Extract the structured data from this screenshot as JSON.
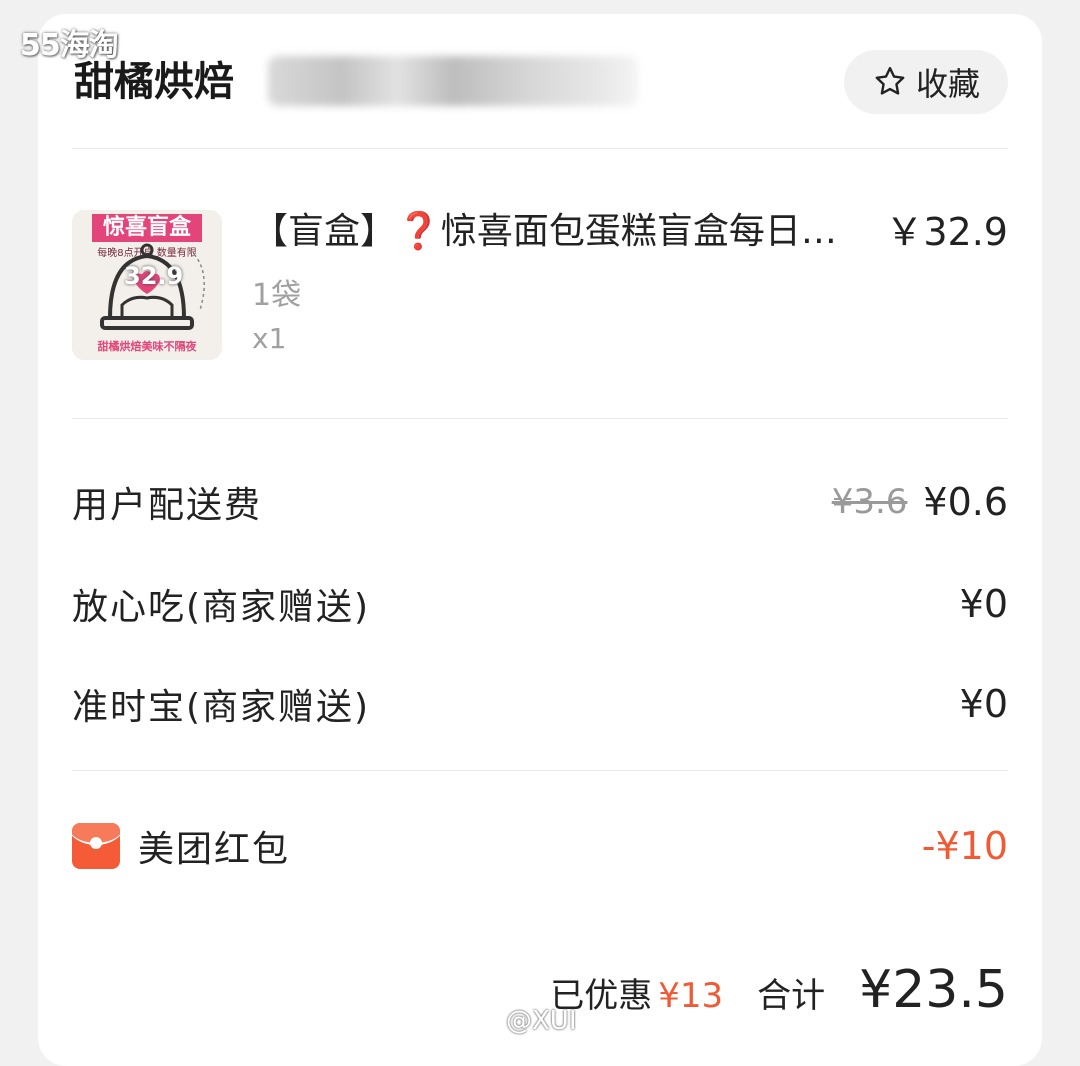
{
  "watermark": "55海淘",
  "shop": {
    "name": "甜橘烘焙",
    "favorite_label": "收藏"
  },
  "product": {
    "title": "【盲盒】❓惊喜面包蛋糕盲盒每日…",
    "price": "￥32.9",
    "spec": "1袋",
    "quantity": "x1",
    "image": {
      "banner": "惊喜盲盒",
      "subtitle": "每晚8点开启 数量有限",
      "price_tag": "32.9",
      "footer": "甜橘烘焙美味不隔夜"
    }
  },
  "fees": [
    {
      "label": "用户配送费",
      "original": "¥3.6",
      "amount": "¥0.6"
    },
    {
      "label": "放心吃(商家赠送)",
      "amount": "¥0"
    },
    {
      "label": "准时宝(商家赠送)",
      "amount": "¥0"
    }
  ],
  "red_packet": {
    "label": "美团红包",
    "amount": "-¥10"
  },
  "summary": {
    "saved_label": "已优惠",
    "saved_amount": "¥13",
    "total_label": "合计",
    "total_amount": "¥23.5"
  },
  "weibo_watermark": "@XUI",
  "colors": {
    "accent_red": "#f05a35",
    "background": "#f1f1f1",
    "card": "#ffffff"
  }
}
